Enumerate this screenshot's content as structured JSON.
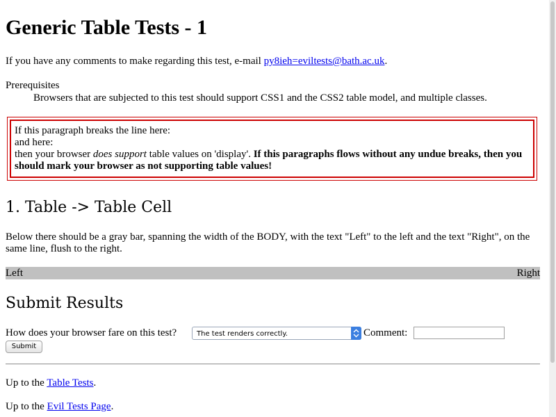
{
  "page": {
    "title": "Generic Table Tests - 1",
    "comments_prefix": "If you have any comments to make regarding this test, e-mail ",
    "email": "py8ieh=eviltests@bath.ac.uk",
    "comments_suffix": ".",
    "prereq_label": "Prerequisites",
    "prereq_text": "Browsers that are subjected to this test should support CSS1 and the CSS2 table model, and multiple classes."
  },
  "testbox": {
    "line1": "If this paragraph breaks the line here:",
    "line2": "and here:",
    "line3_prefix": "then your browser ",
    "line3_em": "does support",
    "line3_suffix": " table values on 'display'. ",
    "line3_bold": "If this paragraphs flows without any undue breaks, then you should mark your browser as not supporting table values!"
  },
  "section1": {
    "heading": "1. Table -> Table Cell",
    "description": "Below there should be a gray bar, spanning the width of the BODY, with the text \"Left\" to the left and the text \"Right\", on the same line, flush to the right.",
    "bar_left": "Left",
    "bar_right": "Right"
  },
  "submit": {
    "heading": "Submit Results",
    "question": "How does your browser fare on this test?",
    "select_value": "The test renders correctly.",
    "comment_label": "Comment:",
    "comment_value": "",
    "button_label": "Submit"
  },
  "footer": {
    "up1_prefix": "Up to the ",
    "up1_link": "Table Tests",
    "up1_suffix": ".",
    "up2_prefix": "Up to the ",
    "up2_link": "Evil Tests Page",
    "up2_suffix": "."
  },
  "colors": {
    "link": "#0000ee",
    "testbox_border": "#cc0000",
    "graybar": "#c0c0c0",
    "select_arrow": "#3b7fe0"
  }
}
